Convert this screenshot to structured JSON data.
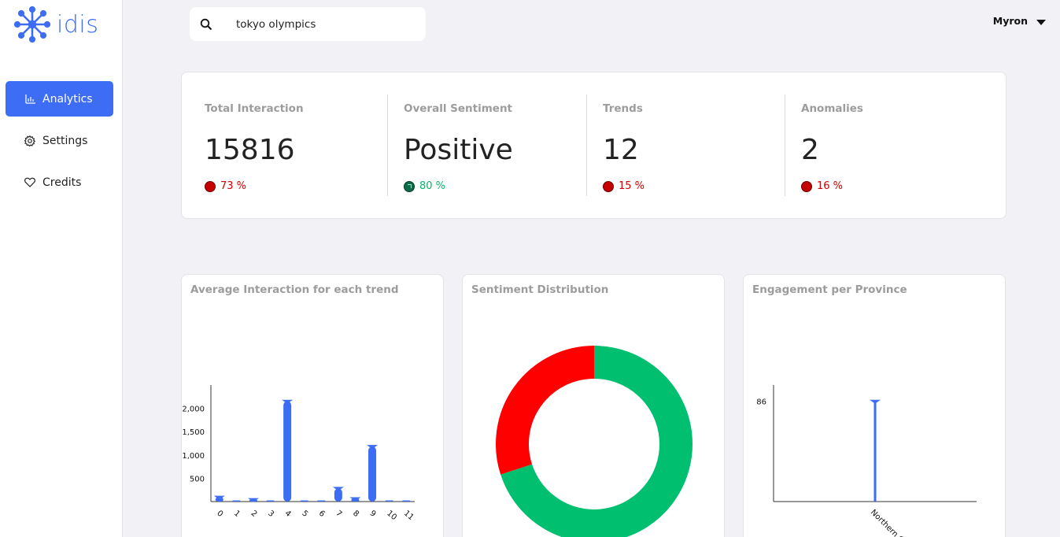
{
  "app": {
    "logo_text": "idis",
    "logo_icon": "starburst-network-icon"
  },
  "sidebar": {
    "items": [
      {
        "label": "Analytics",
        "icon": "bar-chart-icon",
        "active": true
      },
      {
        "label": "Settings",
        "icon": "gear-icon",
        "active": false
      },
      {
        "label": "Credits",
        "icon": "heart-icon",
        "active": false
      }
    ]
  },
  "search": {
    "value": "tokyo olympics",
    "icon": "search-icon"
  },
  "user": {
    "name": "Myron",
    "icon": "caret-down-icon"
  },
  "stats": [
    {
      "label": "Total Interaction",
      "value": "15816",
      "delta": "73 %",
      "direction": "down",
      "color": "#d40000"
    },
    {
      "label": "Overall Sentiment",
      "value": "Positive",
      "delta": "80 %",
      "direction": "up",
      "color": "#00b86b"
    },
    {
      "label": "Trends",
      "value": "12",
      "delta": "15 %",
      "direction": "down",
      "color": "#d40000"
    },
    {
      "label": "Anomalies",
      "value": "2",
      "delta": "16 %",
      "direction": "down",
      "color": "#d40000"
    }
  ],
  "charts": {
    "interaction_title": "Average Interaction for each trend",
    "sentiment_title": "Sentiment Distribution",
    "province_title": "Engagement per Province"
  },
  "chart_data": [
    {
      "type": "bar",
      "title": "Average Interaction for each trend",
      "categories": [
        "0",
        "1",
        "2",
        "3",
        "4",
        "5",
        "6",
        "7",
        "8",
        "9",
        "10",
        "11"
      ],
      "values": [
        90,
        5,
        40,
        5,
        2150,
        8,
        5,
        280,
        60,
        1180,
        5,
        5
      ],
      "yticks": [
        "500",
        "1,000",
        "1,500",
        "2,000"
      ],
      "ytick_values": [
        500,
        1000,
        1500,
        2000
      ],
      "ylim": [
        0,
        2500
      ],
      "color": "#3e6df5"
    },
    {
      "type": "pie",
      "title": "Sentiment Distribution",
      "values": [
        70,
        30
      ],
      "colors": [
        "#00bf6f",
        "#ff0000"
      ],
      "donut": true
    },
    {
      "type": "bar",
      "title": "Engagement per Province",
      "categories": [
        "Northern C..."
      ],
      "values": [
        86
      ],
      "yticks": [
        "86"
      ],
      "ytick_values": [
        86
      ],
      "ylim": [
        0,
        100
      ],
      "color": "#3e6df5"
    }
  ]
}
